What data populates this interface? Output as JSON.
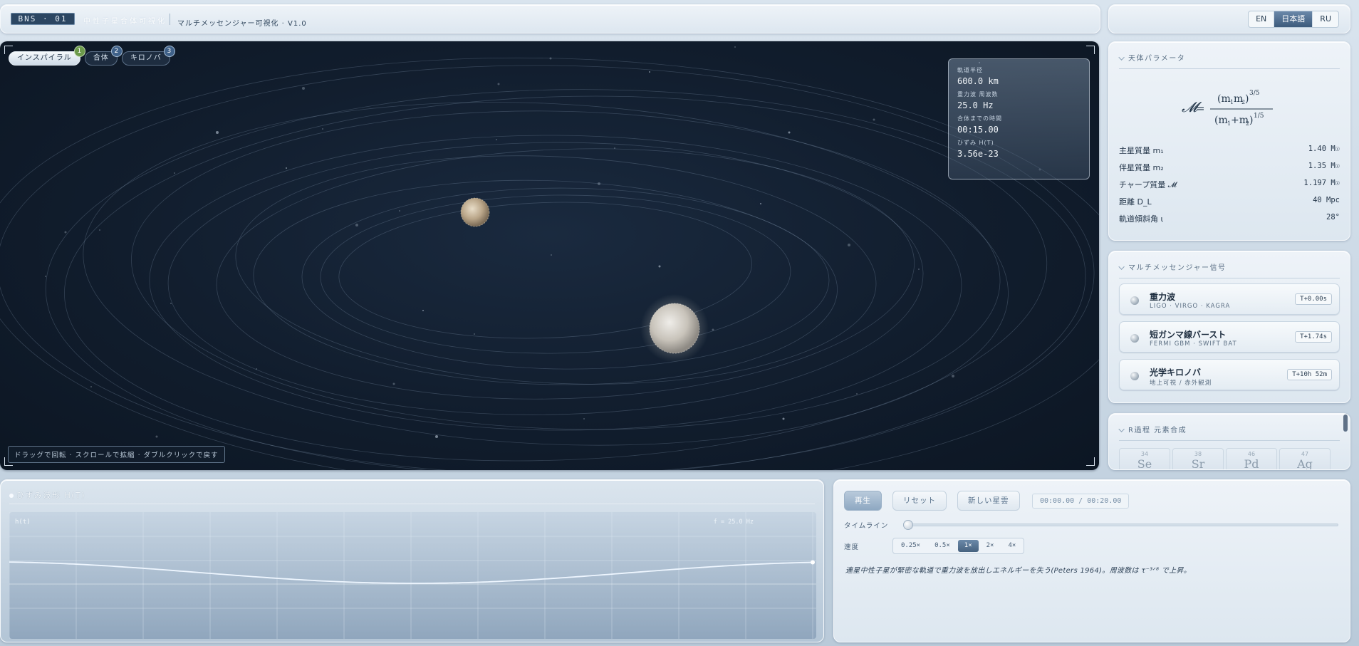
{
  "header": {
    "badge": "BNS · 01",
    "faint_title": "中性子星合体可視化",
    "app_title": "マルチメッセンジャー可視化 · V1.0"
  },
  "languages": [
    {
      "label": "EN",
      "active": false
    },
    {
      "label": "日本語",
      "active": true
    },
    {
      "label": "RU",
      "active": false
    }
  ],
  "stages": [
    {
      "label": "インスパイラル",
      "badge": "1",
      "active": true
    },
    {
      "label": "合体",
      "badge": "2",
      "active": false
    },
    {
      "label": "キロノバ",
      "badge": "3",
      "active": false
    }
  ],
  "readout": [
    {
      "label": "軌道半径",
      "value": "600.0 km"
    },
    {
      "label": "重力波 周波数",
      "value": "25.0 Hz"
    },
    {
      "label": "合体までの時間",
      "value": "00:15.00"
    },
    {
      "label": "ひずみ H(T)",
      "value": "3.56e-23"
    }
  ],
  "hint": "ドラッグで回転 · スクロールで拡縮 · ダブルクリックで戻す",
  "params": {
    "heading": "天体パラメータ",
    "rows": [
      {
        "label": "主星質量 m₁",
        "value": "1.40 M☉"
      },
      {
        "label": "伴星質量 m₂",
        "value": "1.35 M☉"
      },
      {
        "label": "チャープ質量 𝓜",
        "value": "1.197 M☉"
      },
      {
        "label": "距離 D_L",
        "value": "40 Mpc"
      },
      {
        "label": "軌道傾斜角 ι",
        "value": "28°"
      }
    ]
  },
  "signals": {
    "heading": "マルチメッセンジャー信号",
    "items": [
      {
        "title": "重力波",
        "sub": "LIGO · VIRGO · KAGRA",
        "time": "T+0.00s"
      },
      {
        "title": "短ガンマ線バースト",
        "sub": "FERMI GBM · SWIFT BAT",
        "time": "T+1.74s"
      },
      {
        "title": "光学キロノバ",
        "sub": "地上可視 / 赤外観測",
        "time": "T+10h 52m"
      }
    ]
  },
  "rprocess": {
    "heading": "R過程 元素合成",
    "elements": [
      {
        "num": "34",
        "sym": "Se"
      },
      {
        "num": "38",
        "sym": "Sr"
      },
      {
        "num": "46",
        "sym": "Pd"
      },
      {
        "num": "47",
        "sym": "Ag"
      }
    ]
  },
  "waveform": {
    "title": "ひずみ波形 H(T)",
    "ylabel": "h(t)",
    "freq_label": "f = 25.0 Hz"
  },
  "controls": {
    "play": "再生",
    "reset": "リセット",
    "new_star": "新しい星雲",
    "time_display": "00:00.00 / 00:20.00",
    "timeline_label": "タイムライン",
    "timeline_progress": 0.0,
    "speed_label": "速度",
    "speeds": [
      {
        "label": "0.25×",
        "active": false
      },
      {
        "label": "0.5×",
        "active": false
      },
      {
        "label": "1×",
        "active": true
      },
      {
        "label": "2×",
        "active": false
      },
      {
        "label": "4×",
        "active": false
      }
    ],
    "description": "連星中性子星が緊密な軌道で重力波を放出しエネルギーを失う(Peters 1964)。周波数は τ⁻³ᐟ⁸ で上昇。"
  },
  "colors": {
    "space": "#111d2d",
    "accent": "#3d5b7c",
    "badge_green": "#6c9a4b"
  }
}
